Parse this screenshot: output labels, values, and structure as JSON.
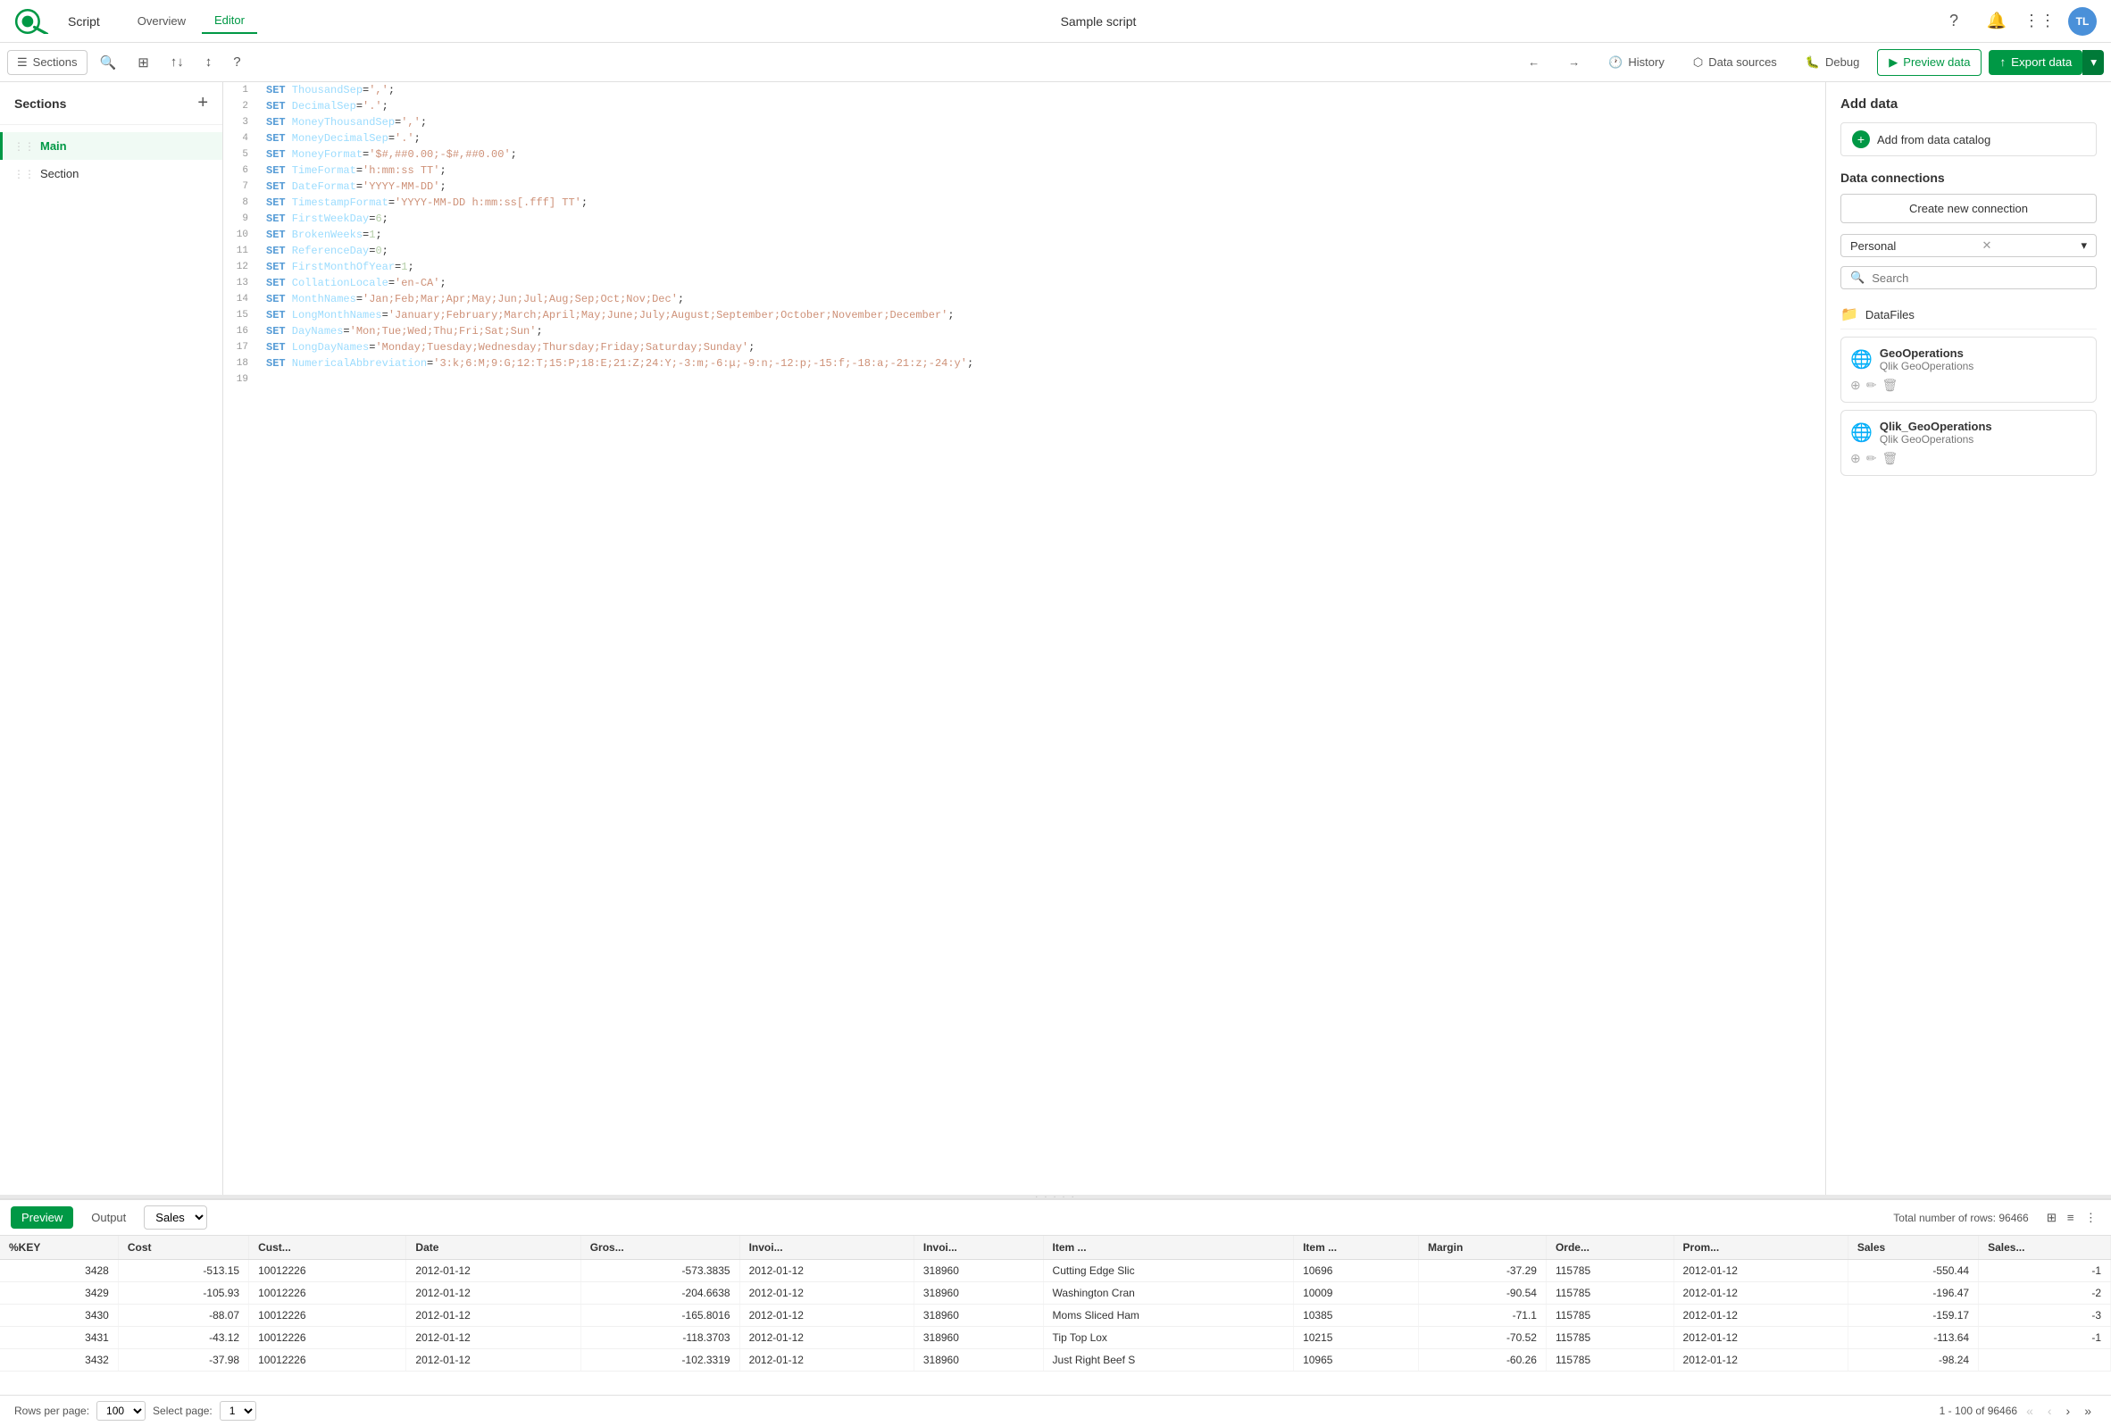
{
  "app": {
    "name": "Script",
    "title": "Sample script",
    "logo_text": "Qlik"
  },
  "nav": {
    "tabs": [
      {
        "id": "overview",
        "label": "Overview"
      },
      {
        "id": "editor",
        "label": "Editor"
      }
    ],
    "active_tab": "editor",
    "avatar": "TL"
  },
  "toolbar": {
    "sections_label": "Sections",
    "history_label": "History",
    "data_sources_label": "Data sources",
    "debug_label": "Debug",
    "preview_label": "Preview data",
    "export_label": "Export data"
  },
  "sidebar": {
    "title": "Sections",
    "add_tooltip": "Add section",
    "items": [
      {
        "id": "main",
        "label": "Main",
        "active": true
      },
      {
        "id": "section",
        "label": "Section",
        "active": false
      }
    ]
  },
  "editor": {
    "lines": [
      {
        "num": 1,
        "code": "SET ThousandSep=',';",
        "tokens": [
          {
            "t": "kw",
            "v": "SET"
          },
          {
            "t": "var",
            "v": " ThousandSep"
          },
          {
            "t": "plain",
            "v": "="
          },
          {
            "t": "str",
            "v": "','"
          },
          {
            "t": "plain",
            "v": ";"
          }
        ]
      },
      {
        "num": 2,
        "code": "SET DecimalSep='.';",
        "tokens": [
          {
            "t": "kw",
            "v": "SET"
          },
          {
            "t": "var",
            "v": " DecimalSep"
          },
          {
            "t": "plain",
            "v": "="
          },
          {
            "t": "str",
            "v": "'.'"
          },
          {
            "t": "plain",
            "v": ";"
          }
        ]
      },
      {
        "num": 3,
        "code": "SET MoneyThousandSep=',';",
        "tokens": [
          {
            "t": "kw",
            "v": "SET"
          },
          {
            "t": "var",
            "v": " MoneyThousandSep"
          },
          {
            "t": "plain",
            "v": "="
          },
          {
            "t": "str",
            "v": "','"
          },
          {
            "t": "plain",
            "v": ";"
          }
        ]
      },
      {
        "num": 4,
        "code": "SET MoneyDecimalSep='.';",
        "tokens": [
          {
            "t": "kw",
            "v": "SET"
          },
          {
            "t": "var",
            "v": " MoneyDecimalSep"
          },
          {
            "t": "plain",
            "v": "="
          },
          {
            "t": "str",
            "v": "'.'"
          },
          {
            "t": "plain",
            "v": ";"
          }
        ]
      },
      {
        "num": 5,
        "code": "SET MoneyFormat='$#,##0.00;-$#,##0.00';",
        "tokens": [
          {
            "t": "kw",
            "v": "SET"
          },
          {
            "t": "var",
            "v": " MoneyFormat"
          },
          {
            "t": "plain",
            "v": "="
          },
          {
            "t": "str",
            "v": "'$#,##0.00;-$#,##0.00'"
          },
          {
            "t": "plain",
            "v": ";"
          }
        ]
      },
      {
        "num": 6,
        "code": "SET TimeFormat='h:mm:ss TT';",
        "tokens": [
          {
            "t": "kw",
            "v": "SET"
          },
          {
            "t": "var",
            "v": " TimeFormat"
          },
          {
            "t": "plain",
            "v": "="
          },
          {
            "t": "str",
            "v": "'h:mm:ss TT'"
          },
          {
            "t": "plain",
            "v": ";"
          }
        ]
      },
      {
        "num": 7,
        "code": "SET DateFormat='YYYY-MM-DD';",
        "tokens": [
          {
            "t": "kw",
            "v": "SET"
          },
          {
            "t": "var",
            "v": " DateFormat"
          },
          {
            "t": "plain",
            "v": "="
          },
          {
            "t": "str",
            "v": "'YYYY-MM-DD'"
          },
          {
            "t": "plain",
            "v": ";"
          }
        ]
      },
      {
        "num": 8,
        "code": "SET TimestampFormat='YYYY-MM-DD h:mm:ss[.fff] TT';",
        "tokens": [
          {
            "t": "kw",
            "v": "SET"
          },
          {
            "t": "var",
            "v": " TimestampFormat"
          },
          {
            "t": "plain",
            "v": "="
          },
          {
            "t": "str",
            "v": "'YYYY-MM-DD h:mm:ss[.fff] TT'"
          },
          {
            "t": "plain",
            "v": ";"
          }
        ]
      },
      {
        "num": 9,
        "code": "SET FirstWeekDay=6;",
        "tokens": [
          {
            "t": "kw",
            "v": "SET"
          },
          {
            "t": "var",
            "v": " FirstWeekDay"
          },
          {
            "t": "plain",
            "v": "="
          },
          {
            "t": "num",
            "v": "6"
          },
          {
            "t": "plain",
            "v": ";"
          }
        ]
      },
      {
        "num": 10,
        "code": "SET BrokenWeeks=1;",
        "tokens": [
          {
            "t": "kw",
            "v": "SET"
          },
          {
            "t": "var",
            "v": " BrokenWeeks"
          },
          {
            "t": "plain",
            "v": "="
          },
          {
            "t": "num",
            "v": "1"
          },
          {
            "t": "plain",
            "v": ";"
          }
        ]
      },
      {
        "num": 11,
        "code": "SET ReferenceDay=0;",
        "tokens": [
          {
            "t": "kw",
            "v": "SET"
          },
          {
            "t": "var",
            "v": " ReferenceDay"
          },
          {
            "t": "plain",
            "v": "="
          },
          {
            "t": "num",
            "v": "0"
          },
          {
            "t": "plain",
            "v": ";"
          }
        ]
      },
      {
        "num": 12,
        "code": "SET FirstMonthOfYear=1;",
        "tokens": [
          {
            "t": "kw",
            "v": "SET"
          },
          {
            "t": "var",
            "v": " FirstMonthOfYear"
          },
          {
            "t": "plain",
            "v": "="
          },
          {
            "t": "num",
            "v": "1"
          },
          {
            "t": "plain",
            "v": ";"
          }
        ]
      },
      {
        "num": 13,
        "code": "SET CollationLocale='en-CA';",
        "tokens": [
          {
            "t": "kw",
            "v": "SET"
          },
          {
            "t": "var",
            "v": " CollationLocale"
          },
          {
            "t": "plain",
            "v": "="
          },
          {
            "t": "str",
            "v": "'en-CA'"
          },
          {
            "t": "plain",
            "v": ";"
          }
        ]
      },
      {
        "num": 14,
        "code": "SET MonthNames='Jan;Feb;Mar;Apr;May;Jun;Jul;Aug;Sep;Oct;Nov;Dec';",
        "tokens": [
          {
            "t": "kw",
            "v": "SET"
          },
          {
            "t": "var",
            "v": " MonthNames"
          },
          {
            "t": "plain",
            "v": "="
          },
          {
            "t": "str",
            "v": "'Jan;Feb;Mar;Apr;May;Jun;Jul;Aug;Sep;Oct;Nov;Dec'"
          },
          {
            "t": "plain",
            "v": ";"
          }
        ]
      },
      {
        "num": 15,
        "code": "SET LongMonthNames='January;February;March;April;May;June;July;August;September;October;November;December';",
        "tokens": [
          {
            "t": "kw",
            "v": "SET"
          },
          {
            "t": "var",
            "v": " LongMonthNames"
          },
          {
            "t": "plain",
            "v": "="
          },
          {
            "t": "str",
            "v": "'January;February;March;April;May;June;July;August;September;October;November;December'"
          },
          {
            "t": "plain",
            "v": ";"
          }
        ]
      },
      {
        "num": 16,
        "code": "SET DayNames='Mon;Tue;Wed;Thu;Fri;Sat;Sun';",
        "tokens": [
          {
            "t": "kw",
            "v": "SET"
          },
          {
            "t": "var",
            "v": " DayNames"
          },
          {
            "t": "plain",
            "v": "="
          },
          {
            "t": "str",
            "v": "'Mon;Tue;Wed;Thu;Fri;Sat;Sun'"
          },
          {
            "t": "plain",
            "v": ";"
          }
        ]
      },
      {
        "num": 17,
        "code": "SET LongDayNames='Monday;Tuesday;Wednesday;Thursday;Friday;Saturday;Sunday';",
        "tokens": [
          {
            "t": "kw",
            "v": "SET"
          },
          {
            "t": "var",
            "v": " LongDayNames"
          },
          {
            "t": "plain",
            "v": "="
          },
          {
            "t": "str",
            "v": "'Monday;Tuesday;Wednesday;Thursday;Friday;Saturday;Sunday'"
          },
          {
            "t": "plain",
            "v": ";"
          }
        ]
      },
      {
        "num": 18,
        "code": "SET NumericalAbbreviation='3:k;6:M;9:G;12:T;15:P;18:E;21:Z;24:Y;-3:m;-6:μ;-9:n;-12:p;-15:f;-18:a;-21:z;-24:y';",
        "tokens": [
          {
            "t": "kw",
            "v": "SET"
          },
          {
            "t": "var",
            "v": " NumericalAbbreviation"
          },
          {
            "t": "plain",
            "v": "="
          },
          {
            "t": "str",
            "v": "'3:k;6:M;9:G;12:T;15:P;18:E;21:Z;24:Y;-3:m;-6:μ;-9:n;-12:p;-15:f;-18:a;-21:z;-24:y'"
          },
          {
            "t": "plain",
            "v": ";"
          }
        ]
      },
      {
        "num": 19,
        "code": "",
        "tokens": []
      }
    ]
  },
  "right_panel": {
    "add_data_title": "Add data",
    "add_catalog_label": "Add from data catalog",
    "data_connections_title": "Data connections",
    "create_connection_label": "Create new connection",
    "search_placeholder": "Search",
    "filter_options": [
      "Personal"
    ],
    "selected_filter": "Personal",
    "folder_items": [
      {
        "id": "datafiles",
        "label": "DataFiles",
        "type": "folder"
      }
    ],
    "connections": [
      {
        "id": "geooperations",
        "name": "GeoOperations",
        "sub": "Qlik GeoOperations",
        "icon": "🌐"
      },
      {
        "id": "qlik_geooperations",
        "name": "Qlik_GeoOperations",
        "sub": "Qlik GeoOperations",
        "icon": "🌐"
      }
    ]
  },
  "bottom": {
    "preview_label": "Preview",
    "output_label": "Output",
    "table_label": "Sales",
    "total_rows": "Total number of rows: 96466",
    "columns": [
      "%KEY",
      "Cost",
      "Cust...",
      "Date",
      "Gros...",
      "Invoi...",
      "Invoi...",
      "Item ...",
      "Item ...",
      "Margin",
      "Orde...",
      "Prom...",
      "Sales",
      "Sales..."
    ],
    "rows": [
      {
        "key": "3428",
        "cost": "-513.15",
        "cust": "10012226",
        "date": "2012-01-12",
        "gross": "-573.3835",
        "inv1": "2012-01-12",
        "inv2": "318960",
        "item1": "Cutting Edge Slic",
        "item2": "10696",
        "margin": "-37.29",
        "order": "115785",
        "prom": "2012-01-12",
        "sales": "-550.44",
        "salesn": "-1"
      },
      {
        "key": "3429",
        "cost": "-105.93",
        "cust": "10012226",
        "date": "2012-01-12",
        "gross": "-204.6638",
        "inv1": "2012-01-12",
        "inv2": "318960",
        "item1": "Washington Cran",
        "item2": "10009",
        "margin": "-90.54",
        "order": "115785",
        "prom": "2012-01-12",
        "sales": "-196.47",
        "salesn": "-2"
      },
      {
        "key": "3430",
        "cost": "-88.07",
        "cust": "10012226",
        "date": "2012-01-12",
        "gross": "-165.8016",
        "inv1": "2012-01-12",
        "inv2": "318960",
        "item1": "Moms Sliced Ham",
        "item2": "10385",
        "margin": "-71.1",
        "order": "115785",
        "prom": "2012-01-12",
        "sales": "-159.17",
        "salesn": "-3"
      },
      {
        "key": "3431",
        "cost": "-43.12",
        "cust": "10012226",
        "date": "2012-01-12",
        "gross": "-118.3703",
        "inv1": "2012-01-12",
        "inv2": "318960",
        "item1": "Tip Top Lox",
        "item2": "10215",
        "margin": "-70.52",
        "order": "115785",
        "prom": "2012-01-12",
        "sales": "-113.64",
        "salesn": "-1"
      },
      {
        "key": "3432",
        "cost": "-37.98",
        "cust": "10012226",
        "date": "2012-01-12",
        "gross": "-102.3319",
        "inv1": "2012-01-12",
        "inv2": "318960",
        "item1": "Just Right Beef S",
        "item2": "10965",
        "margin": "-60.26",
        "order": "115785",
        "prom": "2012-01-12",
        "sales": "-98.24",
        "salesn": ""
      }
    ]
  },
  "pagination": {
    "rows_per_page_label": "Rows per page:",
    "rows_per_page_value": "100",
    "select_page_label": "Select page:",
    "current_page": "1",
    "range_text": "1 - 100 of 96466"
  }
}
